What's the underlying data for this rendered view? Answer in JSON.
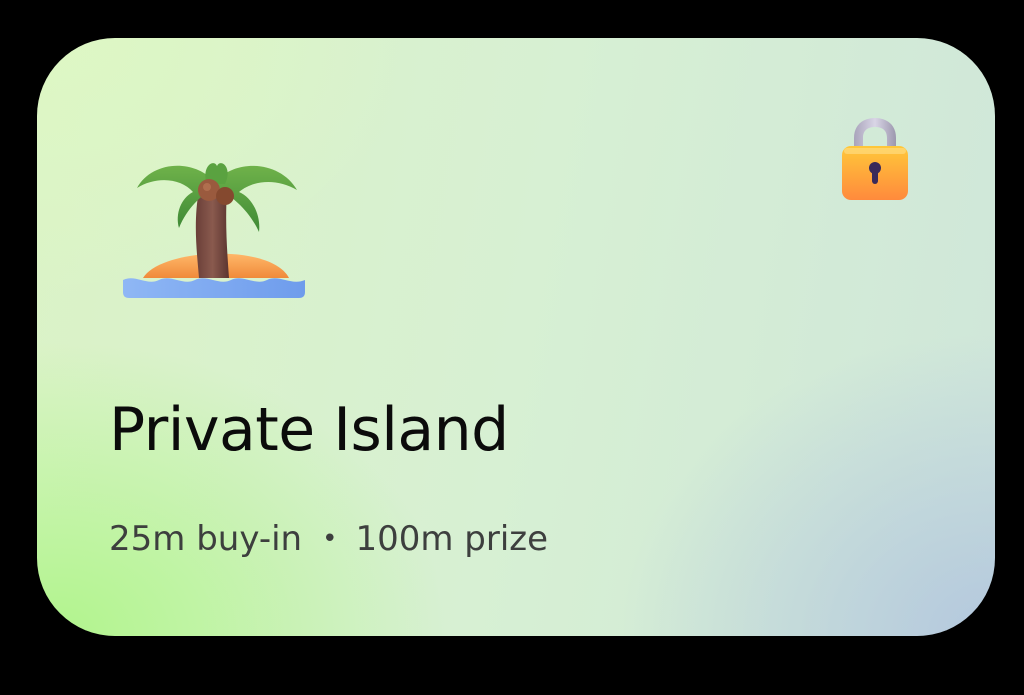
{
  "card": {
    "title": "Private Island",
    "buy_in": "25m buy-in",
    "separator": "•",
    "prize": "100m prize",
    "icons": {
      "main": "desert-island-icon",
      "status": "locked-icon"
    },
    "colors": {
      "gradient_top_left": "#def8c4",
      "gradient_bottom_left": "#aaf582",
      "gradient_bottom_right": "#b2c6de",
      "title": "#0b0b0b",
      "subtitle": "#3d3f3e"
    }
  }
}
